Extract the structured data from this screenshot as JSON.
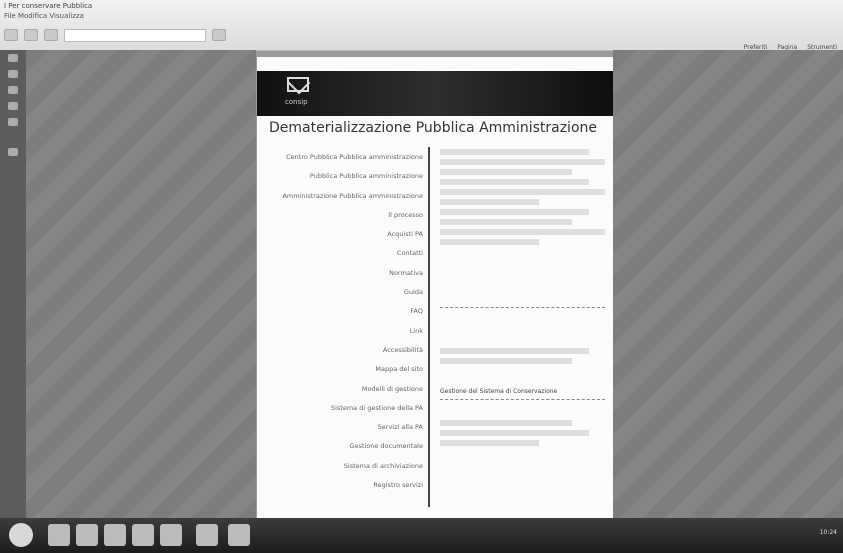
{
  "browser": {
    "title": "I Per conservare Pubblica",
    "menu": "File Modifica Visualizza",
    "right_menu": [
      "Preferiti",
      "Pagina",
      "Strumenti"
    ]
  },
  "page": {
    "logo_text": "consip",
    "title": "Dematerializzazione Pubblica Amministrazione",
    "nav_items": [
      "Centro Pubblica Pubblica amministrazione",
      "Pubblica Pubblica amministrazione",
      "Amministrazione Pubblica amministrazione",
      "Il processo",
      "Acquisti PA",
      "Contatti",
      "Normativa",
      "Guida",
      "FAQ",
      "Link",
      "Accessibilità",
      "Mappa del sito",
      "Modelli di gestione",
      "Sistema di gestione della PA",
      "Servizi alla PA",
      "Gestione documentale",
      "Sistema di archiviazione",
      "Registro servizi"
    ],
    "content_label": "Gestione del Sistema di Conservazione"
  },
  "taskbar": {
    "tray_text": "10:24"
  }
}
